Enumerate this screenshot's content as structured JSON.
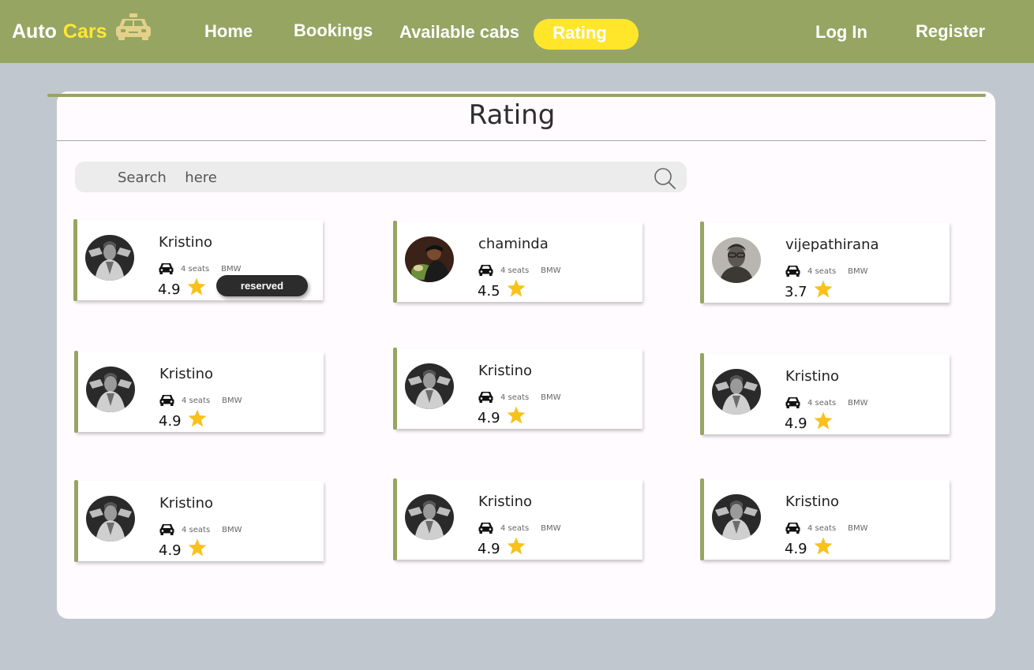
{
  "brand": {
    "word1": "Auto",
    "word2": "Cars",
    "accent_color": "#ffe733",
    "icon": "taxi-icon"
  },
  "nav": {
    "home": "Home",
    "bookings": "Bookings",
    "available_cabs": "Available cabs",
    "rating": "Rating",
    "login": "Log In",
    "register": "Register"
  },
  "colors": {
    "header": "#96a562",
    "background": "#c0c7cf",
    "active_pill": "#ffe62a",
    "star": "#f9c21a"
  },
  "page": {
    "title": "Rating"
  },
  "search": {
    "placeholder": "Search  here",
    "value": "",
    "icon": "search-icon"
  },
  "drivers": [
    {
      "name": "Kristino",
      "seats": "4 seats",
      "make": "BMW",
      "rating": "4.9",
      "status": "reserved"
    },
    {
      "name": "chaminda",
      "seats": "4 seats",
      "make": "BMW",
      "rating": "4.5"
    },
    {
      "name": "vijepathirana",
      "seats": "4 seats",
      "make": "BMW",
      "rating": "3.7"
    },
    {
      "name": "Kristino",
      "seats": "4 seats",
      "make": "BMW",
      "rating": "4.9"
    },
    {
      "name": "Kristino",
      "seats": "4 seats",
      "make": "BMW",
      "rating": "4.9"
    },
    {
      "name": "Kristino",
      "seats": "4 seats",
      "make": "BMW",
      "rating": "4.9"
    },
    {
      "name": "Kristino",
      "seats": "4 seats",
      "make": "BMW",
      "rating": "4.9"
    },
    {
      "name": "Kristino",
      "seats": "4 seats",
      "make": "BMW",
      "rating": "4.9"
    },
    {
      "name": "Kristino",
      "seats": "4 seats",
      "make": "BMW",
      "rating": "4.9"
    }
  ]
}
